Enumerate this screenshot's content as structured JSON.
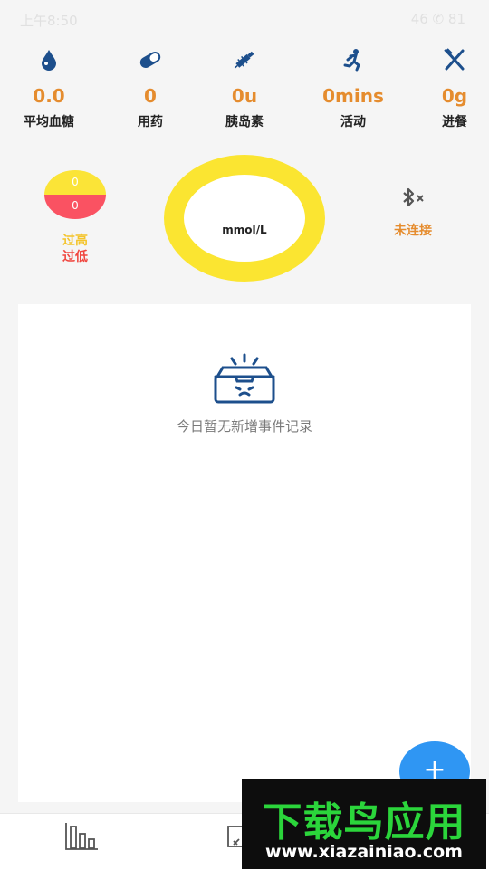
{
  "status_bar": {
    "time": "上午8:50",
    "right": "46 ✆ 81"
  },
  "stats": [
    {
      "icon": "blood-drop-icon",
      "value": "0.0",
      "label": "平均血糖"
    },
    {
      "icon": "pill-icon",
      "value": "0",
      "label": "用药"
    },
    {
      "icon": "syringe-icon",
      "value": "0u",
      "label": "胰岛素"
    },
    {
      "icon": "running-icon",
      "value": "0mins",
      "label": "活动"
    },
    {
      "icon": "fork-knife-icon",
      "value": "0g",
      "label": "进餐"
    }
  ],
  "range_badge": {
    "high_count": "0",
    "low_count": "0",
    "high_label": "过高",
    "low_label": "过低",
    "high_color": "#fbe437",
    "low_color": "#fa5262"
  },
  "glucose_ring": {
    "unit": "mmol/L",
    "ring_color": "#fbe531"
  },
  "bluetooth": {
    "icon": "bluetooth-off-icon",
    "status": "未连接"
  },
  "events": {
    "empty_icon": "empty-inbox-icon",
    "empty_text": "今日暂无新增事件记录"
  },
  "fab": {
    "label": "+",
    "color": "#2f96f3"
  },
  "tabbar": {
    "tabs": [
      {
        "icon": "bar-chart-icon"
      },
      {
        "icon": "record-icon"
      }
    ]
  },
  "watermark": {
    "title": "下载鸟应用",
    "url": "www.xiazainiao.com"
  },
  "colors": {
    "accent": "#e58c2e",
    "icon_blue": "#1d4f8c"
  }
}
